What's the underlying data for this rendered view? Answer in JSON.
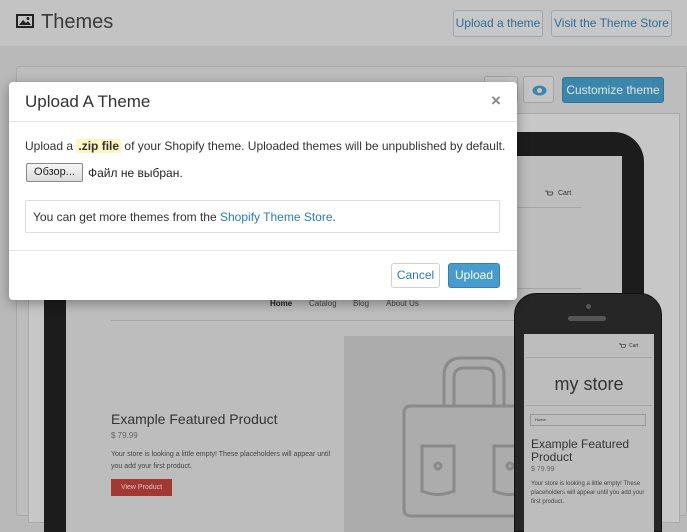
{
  "header": {
    "title": "Themes",
    "upload_theme_label": "Upload a theme",
    "visit_store_label": "Visit the Theme Store"
  },
  "panel": {
    "customize_label": "Customize theme"
  },
  "preview": {
    "tablet": {
      "cart_label": "Cart",
      "nav": [
        "Home",
        "Catalog",
        "Blog",
        "About Us"
      ],
      "product_title": "Example Featured Product",
      "price": "$ 79.99",
      "description": "Your store is looking a little empty! These placeholders will appear until you add your first product.",
      "button_label": "View Product"
    },
    "phone": {
      "cart_label": "Cart",
      "store_name": "my store",
      "select_value": "Home",
      "product_title": "Example Featured Product",
      "price": "$ 79.99",
      "description": "Your store is looking a little empty! These placeholders will appear until you add your first product."
    }
  },
  "modal": {
    "title": "Upload A Theme",
    "close_symbol": "×",
    "intro_before": "Upload a",
    "intro_highlight": ".zip file",
    "intro_after": "of your Shopify theme. Uploaded themes will be unpublished by default.",
    "file_button_label": "Обзор...",
    "file_status": "Файл не выбран.",
    "info_before": "You can get more themes from the",
    "info_link": "Shopify Theme Store",
    "info_after": ".",
    "cancel_label": "Cancel",
    "upload_label": "Upload"
  },
  "colors": {
    "primary_button": "#479ccf",
    "link": "#2a7cb5",
    "highlight": "#fdf6c3",
    "overlay_bg": "#b9b9b9"
  }
}
